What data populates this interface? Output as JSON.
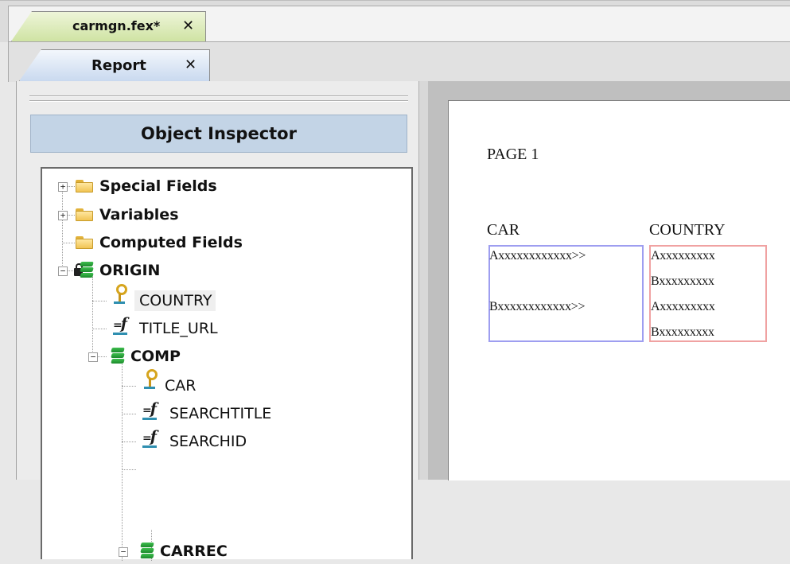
{
  "document_tab": {
    "label": "carmgn.fex*",
    "close": "✕"
  },
  "report_tab": {
    "label": "Report",
    "close": "✕"
  },
  "object_inspector": {
    "title": "Object Inspector",
    "tree": [
      {
        "label": "Special Fields",
        "type": "folder",
        "expander": "+"
      },
      {
        "label": "Variables",
        "type": "folder",
        "expander": "+"
      },
      {
        "label": "Computed Fields",
        "type": "folder"
      },
      {
        "label": "ORIGIN",
        "type": "segment",
        "expander": "−"
      },
      {
        "label": "COUNTRY",
        "type": "key"
      },
      {
        "label": "TITLE_URL",
        "type": "field"
      },
      {
        "label": "COMP",
        "type": "segment",
        "expander": "−"
      },
      {
        "label": "CAR",
        "type": "key"
      },
      {
        "label": "SEARCHTITLE",
        "type": "field"
      },
      {
        "label": "SEARCHID",
        "type": "field"
      },
      {
        "label": "CARREC",
        "type": "segment",
        "expander": "−"
      }
    ]
  },
  "report": {
    "page_label": "PAGE 1",
    "columns": {
      "car": {
        "header": "CAR",
        "values": [
          "Axxxxxxxxxxxx>>",
          "Bxxxxxxxxxxxx>>"
        ]
      },
      "country": {
        "header": "COUNTRY",
        "values": [
          "Axxxxxxxxx",
          "Bxxxxxxxxx",
          "Axxxxxxxxx",
          "Bxxxxxxxxx"
        ]
      }
    }
  }
}
